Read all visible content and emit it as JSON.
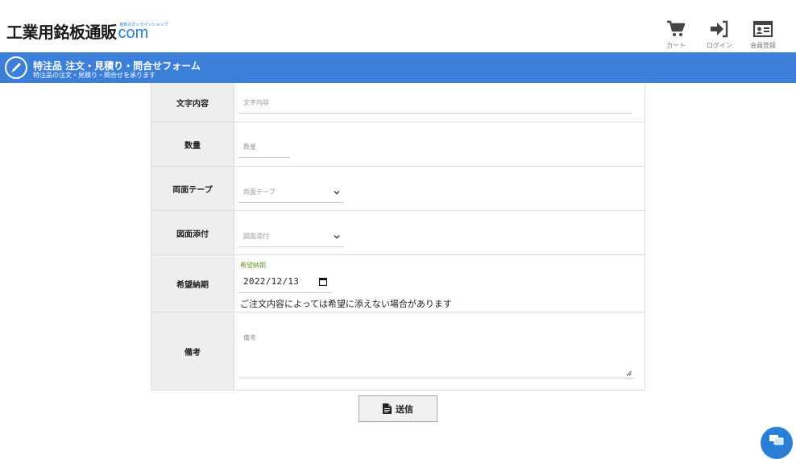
{
  "header": {
    "logo_main": "工業用銘板通販",
    "logo_com": "com",
    "logo_tagline": "銘板のオンラインショップ",
    "nav": [
      {
        "label": "カート",
        "icon": "cart-icon"
      },
      {
        "label": "ログイン",
        "icon": "login-icon"
      },
      {
        "label": "会員登録",
        "icon": "member-card-icon"
      }
    ]
  },
  "titlebar": {
    "title": "特注品 注文・見積り・問合せフォーム",
    "subtitle": "特注品の注文・見積り・問合せを承ります",
    "icon": "pencil-icon"
  },
  "form": {
    "rows": [
      {
        "label": "文字内容",
        "placeholder": "文字内容"
      },
      {
        "label": "数量",
        "placeholder": "数量"
      },
      {
        "label": "両面テープ",
        "placeholder": "両面テープ"
      },
      {
        "label": "図面添付",
        "placeholder": "図面添付"
      },
      {
        "label": "希望納期",
        "field_label": "希望納期",
        "value": "2022/12/13",
        "note": "ご注文内容によっては希望に添えない場合があります"
      },
      {
        "label": "備考",
        "placeholder": "備考"
      }
    ]
  },
  "submit": {
    "label": "送信",
    "icon": "document-icon"
  },
  "colors": {
    "brand_blue": "#3b7fd9",
    "logo_blue": "#2a7fd4",
    "date_label_green": "#6a9a2a"
  }
}
